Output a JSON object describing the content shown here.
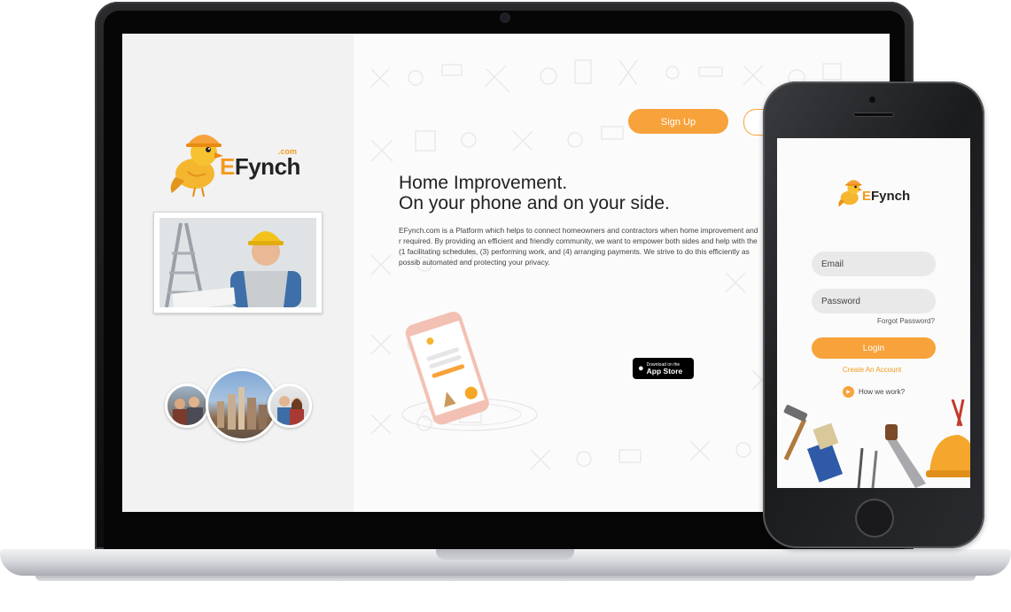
{
  "site": {
    "brand_letter": "E",
    "brand_rest": "Fynch",
    "brand_com": ".com",
    "signup_label": "Sign Up",
    "hero_line1": "Home Improvement.",
    "hero_line2": "On your phone and on your side.",
    "hero_body": "EFynch.com is a Platform which helps to connect homeowners and contractors when home improvement and r required. By providing an efficient and friendly community, we want to empower both sides and help with the (1 facilitating schedules, (3) performing work, and (4) arranging payments. We strive to do this efficiently as possib automated and protecting your privacy.",
    "appstore_small": "Download on the",
    "appstore_big": "App Store"
  },
  "phone": {
    "brand_letter": "E",
    "brand_rest": "Fynch",
    "email_placeholder": "Email",
    "password_placeholder": "Password",
    "forgot_label": "Forgot Password?",
    "login_label": "Login",
    "create_label": "Create An Account",
    "how_label": "How we work?"
  },
  "colors": {
    "accent": "#f7a23a",
    "brand_orange": "#f39a1e"
  }
}
